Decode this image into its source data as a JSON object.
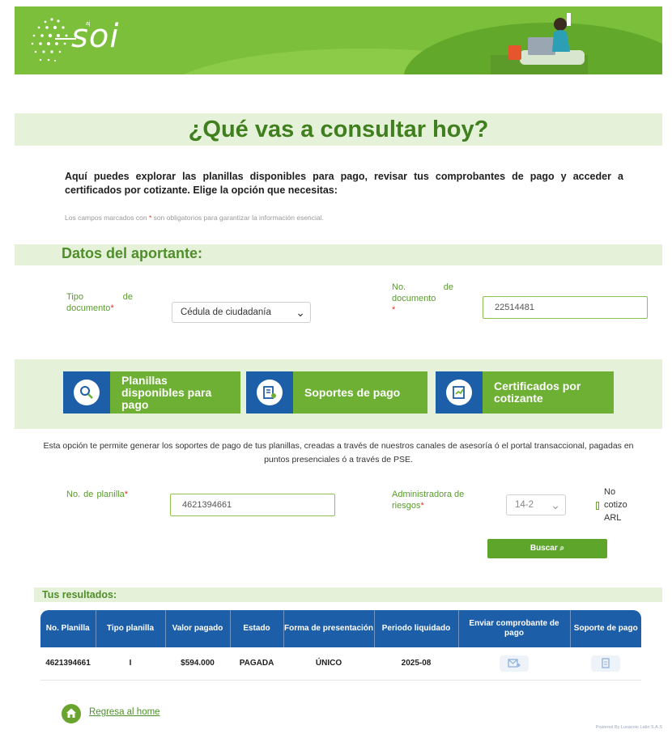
{
  "header": {
    "logo_text": "SOI",
    "logo_small": "aj"
  },
  "page_title": "¿Qué vas a consultar hoy?",
  "intro": "Aquí puedes explorar las planillas disponibles para pago, revisar tus comprobantes de pago y acceder a certificados por cotizante. Elige la opción que necesitas:",
  "required_note": {
    "before": "Los campos marcados con",
    "star": "*",
    "after": "son obligatorios para garantizar la información esencial."
  },
  "aportante": {
    "section_title": "Datos del aportante:",
    "tipo_label": "Tipo de documento",
    "tipo_value": "Cédula de ciudadanía",
    "numero_label": "No. de documento",
    "numero_value": "22514481",
    "star": "*"
  },
  "options": [
    {
      "label": "Planillas disponibles para pago",
      "icon": "search-document-icon"
    },
    {
      "label": "Soportes de pago",
      "icon": "receipt-icon"
    },
    {
      "label": "Certificados por cotizante",
      "icon": "certificate-icon"
    }
  ],
  "soportes": {
    "description": "Esta opción te permite generar los soportes de pago de tus planillas, creadas a través de nuestros canales de asesoría ó el portal transaccional, pagadas en puntos presenciales ó a través de PSE.",
    "planilla_label": "No. de planilla",
    "planilla_value": "4621394661",
    "arl_label": "Administradora de riesgos",
    "arl_value": "14-2",
    "no_cotizo_label": "No cotizo ARL",
    "search_label": "Buscar",
    "star": "*"
  },
  "results": {
    "title": "Tus resultados:",
    "columns": [
      "No. Planilla",
      "Tipo planilla",
      "Valor pagado",
      "Estado",
      "Forma de presentación",
      "Periodo liquidado",
      "Enviar comprobante de pago",
      "Soporte de pago"
    ],
    "rows": [
      [
        "4621394661",
        "I",
        "$594.000",
        "PAGADA",
        "ÚNICO",
        "2025-08"
      ]
    ]
  },
  "footer": {
    "home_link": "Regresa al home",
    "powered": "Powered By Luxacoio Latin S.A.S"
  },
  "colors": {
    "brand_green": "#7cbf3a",
    "dark_green": "#4f8f2b",
    "light_green": "#e6f1d9",
    "blue": "#1d5ea8",
    "required": "#e0342b"
  }
}
